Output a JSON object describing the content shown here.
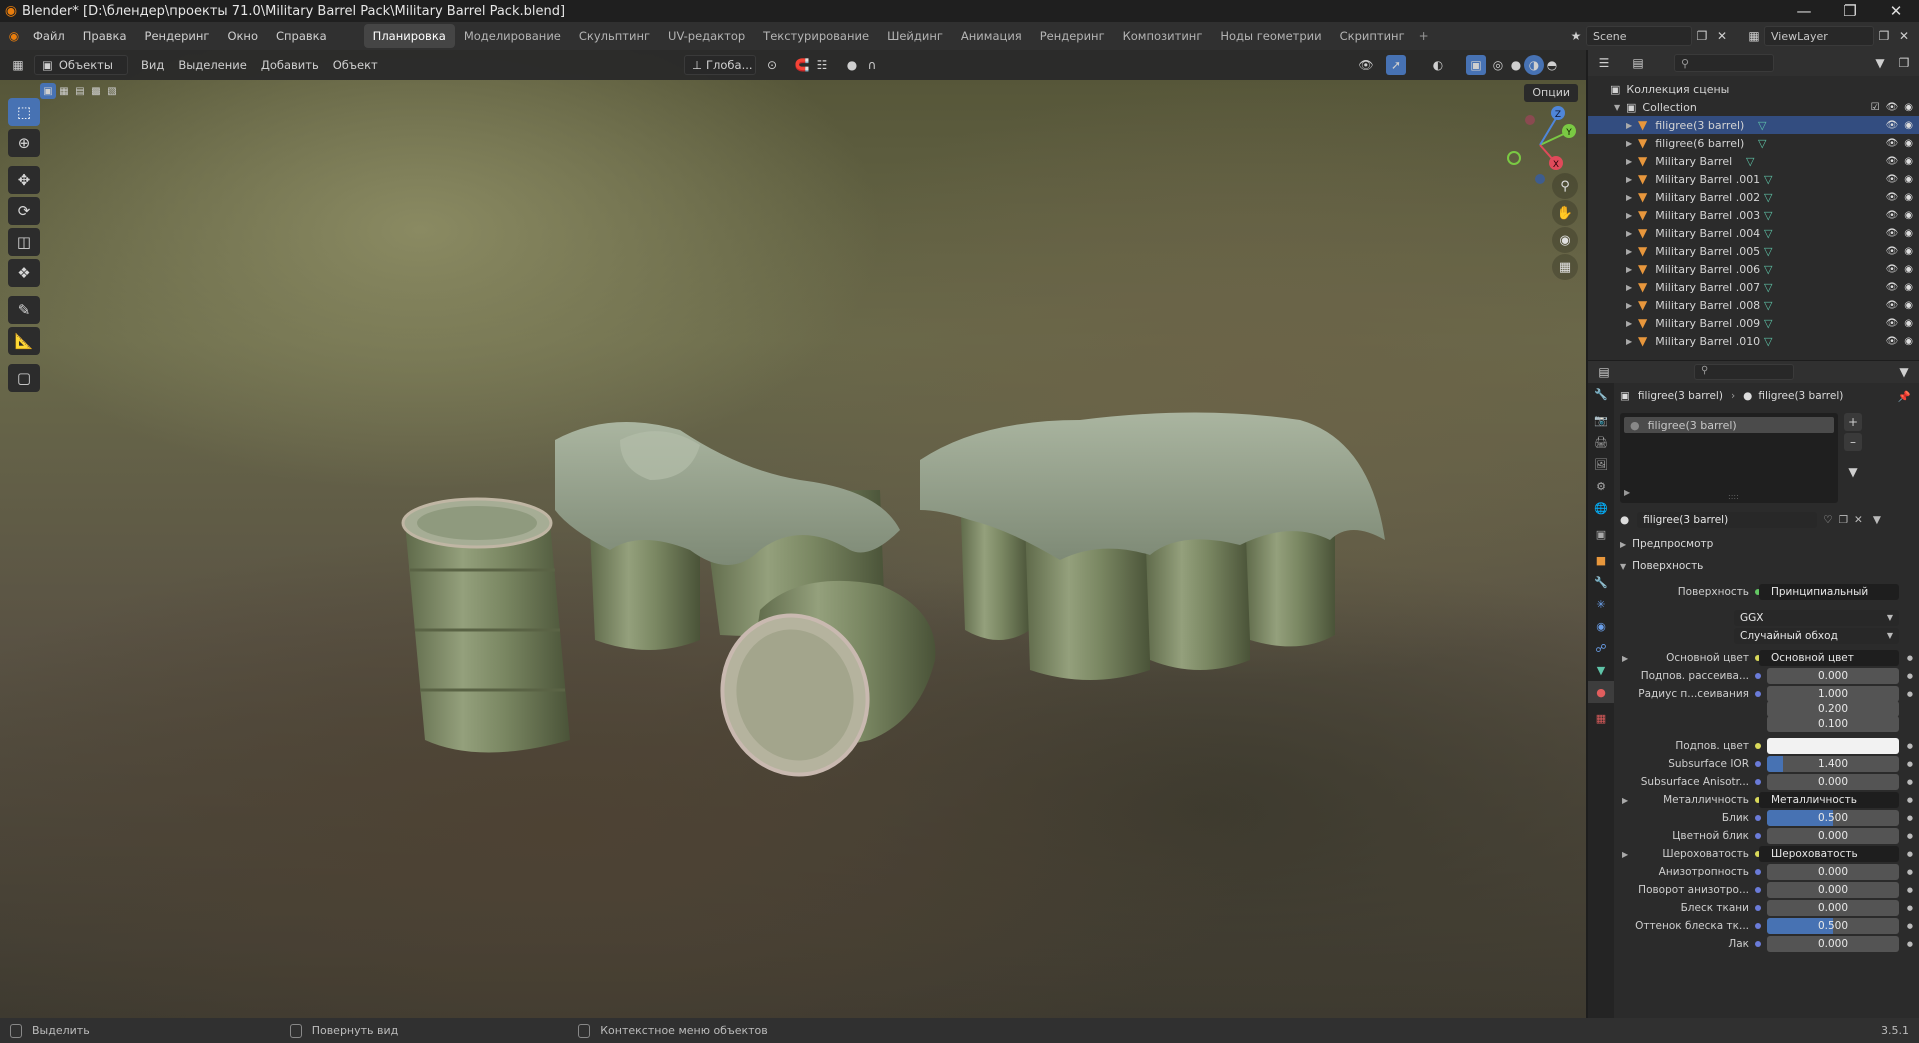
{
  "title_bar": {
    "title": "Blender* [D:\\блендер\\проекты 71.0\\Military Barrel Pack\\Military Barrel Pack.blend]"
  },
  "menu": [
    "Файл",
    "Правка",
    "Рендеринг",
    "Окно",
    "Справка"
  ],
  "workspaces": [
    {
      "label": "Планировка",
      "active": true
    },
    {
      "label": "Моделирование",
      "active": false
    },
    {
      "label": "Скульптинг",
      "active": false
    },
    {
      "label": "UV-редактор",
      "active": false
    },
    {
      "label": "Текстурирование",
      "active": false
    },
    {
      "label": "Шейдинг",
      "active": false
    },
    {
      "label": "Анимация",
      "active": false
    },
    {
      "label": "Рендеринг",
      "active": false
    },
    {
      "label": "Композитинг",
      "active": false
    },
    {
      "label": "Ноды геометрии",
      "active": false
    },
    {
      "label": "Скриптинг",
      "active": false
    }
  ],
  "scene": {
    "scene_name": "Scene",
    "view_layer": "ViewLayer"
  },
  "viewport": {
    "mode": "Объекты",
    "menu": [
      "Вид",
      "Выделение",
      "Добавить",
      "Объект"
    ],
    "transform": "Глоба...",
    "options": "Опции",
    "gizmo": {
      "x": "X",
      "y": "Y",
      "z": "Z"
    }
  },
  "outliner": {
    "scene_collection": "Коллекция сцены",
    "collection": "Collection",
    "items": [
      {
        "name": "filigree(3 barrel)",
        "selected": true
      },
      {
        "name": "filigree(6 barrel)",
        "selected": false
      },
      {
        "name": "Military Barrel",
        "selected": false
      },
      {
        "name": "Military Barrel .001",
        "selected": false
      },
      {
        "name": "Military Barrel .002",
        "selected": false
      },
      {
        "name": "Military Barrel .003",
        "selected": false
      },
      {
        "name": "Military Barrel .004",
        "selected": false
      },
      {
        "name": "Military Barrel .005",
        "selected": false
      },
      {
        "name": "Military Barrel .006",
        "selected": false
      },
      {
        "name": "Military Barrel .007",
        "selected": false
      },
      {
        "name": "Military Barrel .008",
        "selected": false
      },
      {
        "name": "Military Barrel .009",
        "selected": false
      },
      {
        "name": "Military Barrel .010",
        "selected": false
      }
    ]
  },
  "properties": {
    "breadcrumb_object": "filigree(3 barrel)",
    "breadcrumb_material": "filigree(3 barrel)",
    "slot": "filigree(3 barrel)",
    "material_name": "filigree(3 barrel)",
    "preview": "Предпросмотр",
    "surface_section": "Поверхность",
    "surface_label": "Поверхность",
    "surface_value": "Принципиальный BSDF",
    "distribution": "GGX",
    "subsurface_method": "Случайный обход",
    "rows": [
      {
        "label": "Основной цвет",
        "value": "Основной цвет",
        "kind": "link",
        "fill": 0
      },
      {
        "label": "Подпов. рассеива...",
        "value": "0.000",
        "kind": "num",
        "fill": 0
      },
      {
        "label": "Радиус п...сеивания",
        "value": "1.000",
        "kind": "num",
        "fill": 0
      },
      {
        "label": "",
        "value": "0.200",
        "kind": "num",
        "fill": 0
      },
      {
        "label": "",
        "value": "0.100",
        "kind": "num",
        "fill": 0
      },
      {
        "label": "Подпов. цвет",
        "value": "",
        "kind": "color",
        "fill": 0
      },
      {
        "label": "Subsurface IOR",
        "value": "1.400",
        "kind": "num",
        "fill": 0.12
      },
      {
        "label": "Subsurface Anisotr...",
        "value": "0.000",
        "kind": "num",
        "fill": 0
      },
      {
        "label": "Металличность",
        "value": "Металличность",
        "kind": "link",
        "fill": 0
      },
      {
        "label": "Блик",
        "value": "0.500",
        "kind": "num",
        "fill": 0.5
      },
      {
        "label": "Цветной блик",
        "value": "0.000",
        "kind": "num",
        "fill": 0
      },
      {
        "label": "Шероховатость",
        "value": "Шероховатость",
        "kind": "link",
        "fill": 0
      },
      {
        "label": "Анизотропность",
        "value": "0.000",
        "kind": "num",
        "fill": 0
      },
      {
        "label": "Поворот анизотро...",
        "value": "0.000",
        "kind": "num",
        "fill": 0
      },
      {
        "label": "Блеск ткани",
        "value": "0.000",
        "kind": "num",
        "fill": 0
      },
      {
        "label": "Оттенок блеска тк...",
        "value": "0.500",
        "kind": "num",
        "fill": 0.5
      },
      {
        "label": "Лак",
        "value": "0.000",
        "kind": "num",
        "fill": 0
      }
    ]
  },
  "status_bar": {
    "select": "Выделить",
    "rotate": "Повернуть вид",
    "context": "Контекстное меню объектов",
    "version": "3.5.1"
  },
  "colors": {
    "accent": "#4772b3",
    "selected_row": "#334d80",
    "mesh_icon": "#5fc4a8",
    "object_icon": "#e8973c"
  }
}
